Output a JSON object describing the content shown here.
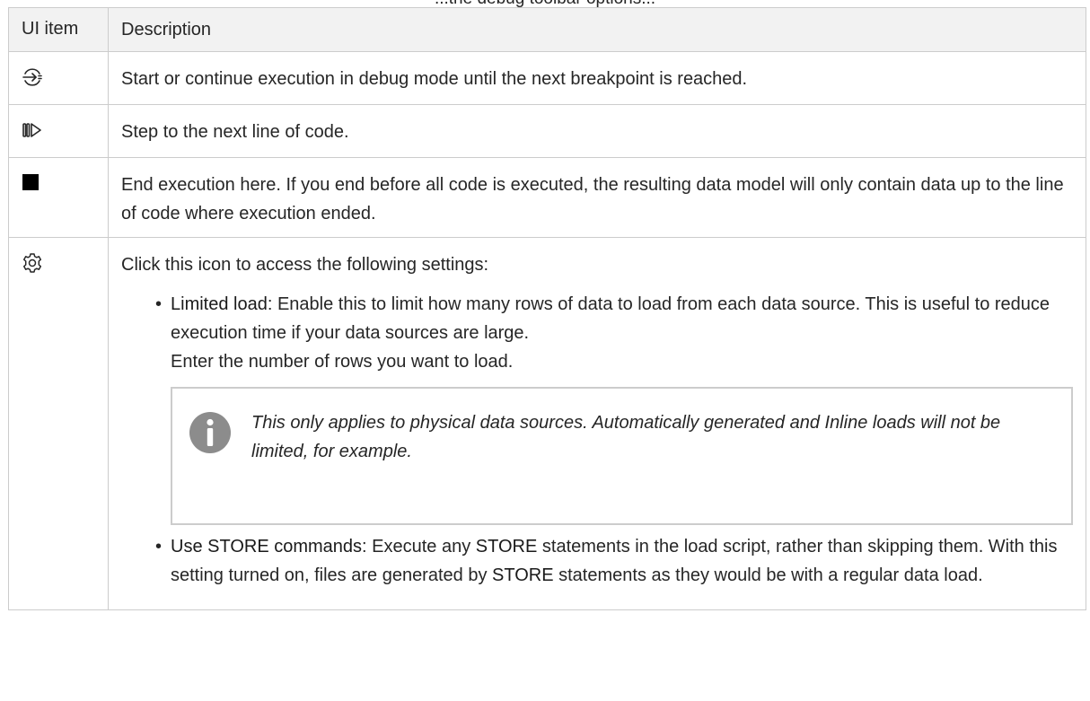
{
  "caption": "...the debug toolbar options...",
  "table": {
    "headers": {
      "ui_item": "UI item",
      "description": "Description"
    },
    "rows": [
      {
        "icon": "debug-run-icon",
        "description": "Start or continue execution in debug mode until the next breakpoint is reached."
      },
      {
        "icon": "step-icon",
        "description": "Step to the next line of code."
      },
      {
        "icon": "stop-icon",
        "description": "End execution here. If you end before all code is executed, the resulting data model will only contain data up to the line of code where execution ended."
      },
      {
        "icon": "gear-icon",
        "description": "Click this icon to access the following settings:",
        "options": [
          {
            "term": "Limited load",
            "text_1": ": Enable this to limit how many rows of data to load from each data source. This is useful to reduce execution time if your data sources are large.",
            "text_2": "Enter the number of rows you want to load.",
            "note": "This only applies to physical data sources. Automatically generated and Inline loads will not be limited, for example."
          },
          {
            "term": "Use STORE commands",
            "text_a": ": Execute any ",
            "keyword_1": "STORE",
            "text_b": " statements in the load script, rather than skipping them. With this setting turned on, files are generated by ",
            "keyword_2": "STORE",
            "text_c": " statements as they would be with a regular data load."
          }
        ]
      }
    ]
  },
  "colors": {
    "border": "#cccccc",
    "header_bg": "#f2f2f2",
    "text": "#262626",
    "note_icon": "#8c8c8c"
  }
}
